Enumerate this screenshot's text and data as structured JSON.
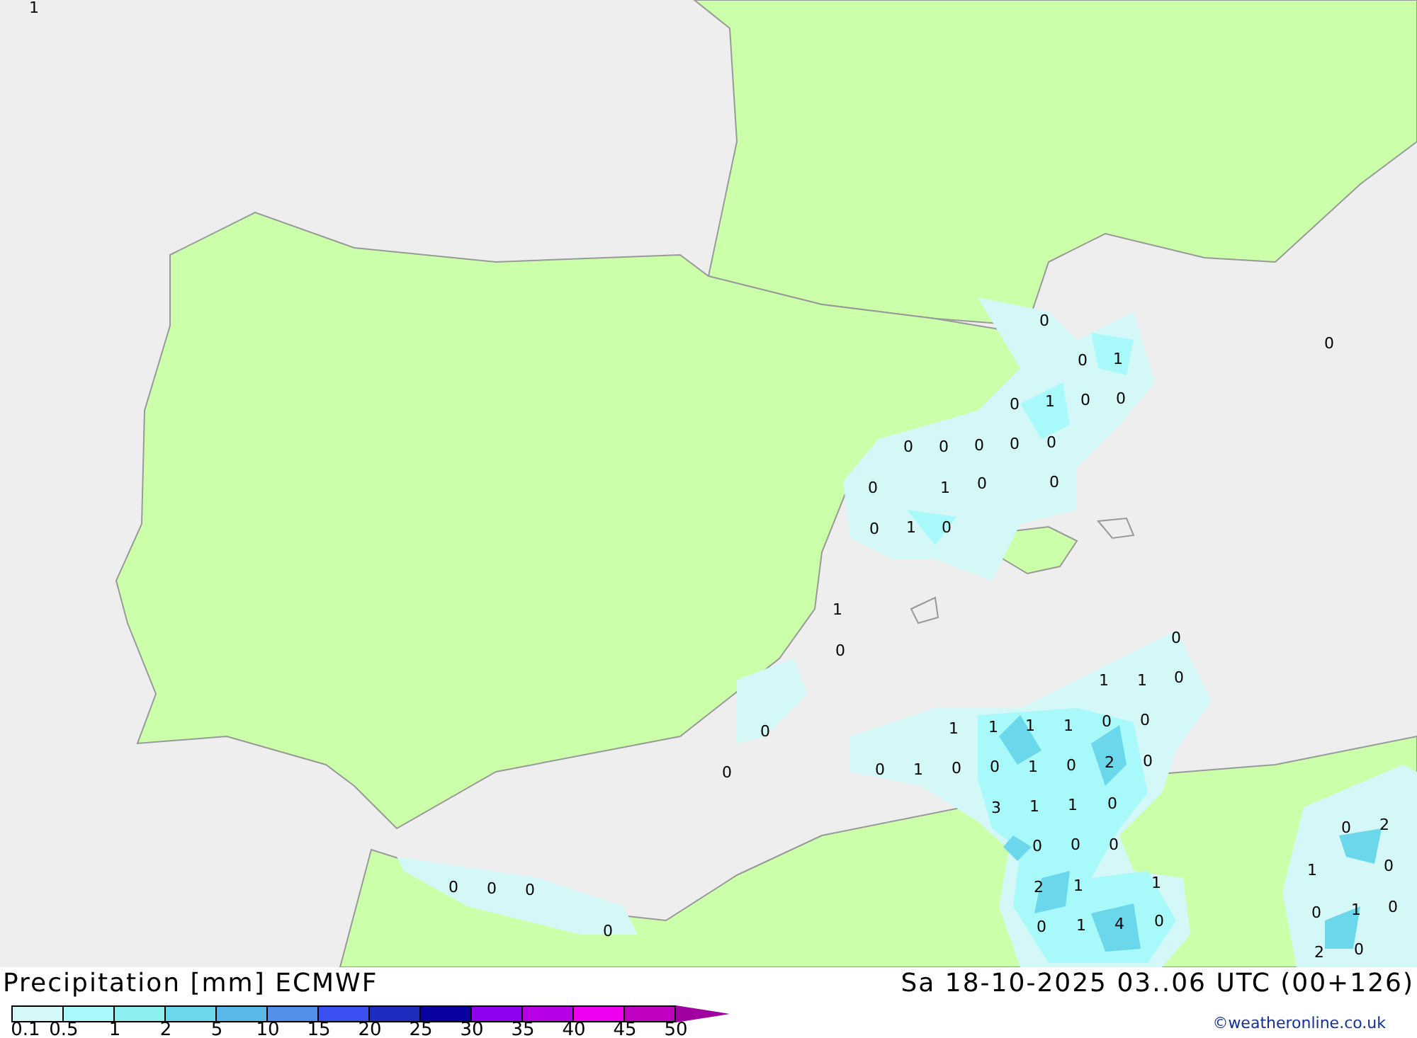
{
  "map": {
    "values": [
      "1",
      "0",
      "0",
      "0",
      "1",
      "0",
      "1",
      "0",
      "0",
      "0",
      "0",
      "0",
      "0",
      "0",
      "0",
      "1",
      "0",
      "0",
      "0",
      "1",
      "0",
      "1",
      "0",
      "0",
      "0",
      "0",
      "1",
      "1",
      "0",
      "1",
      "1",
      "1",
      "1",
      "0",
      "0",
      "0",
      "1",
      "0",
      "0",
      "1",
      "0",
      "2",
      "0",
      "3",
      "1",
      "1",
      "0",
      "0",
      "0",
      "0",
      "2",
      "1",
      "1",
      "0",
      "1",
      "4",
      "0",
      "0",
      "0",
      "0",
      "0",
      "0",
      "2",
      "1",
      "0",
      "0",
      "1",
      "0",
      "2",
      "0"
    ]
  },
  "title": "Precipitation [mm] ECMWF",
  "timestamp": "Sa 18-10-2025 03..06 UTC (00+126)",
  "legend": {
    "swatches": [
      {
        "color": "#d4f8f8"
      },
      {
        "color": "#a8fafa"
      },
      {
        "color": "#8ceeee"
      },
      {
        "color": "#6ad8ea"
      },
      {
        "color": "#58b8e8"
      },
      {
        "color": "#5090e8"
      },
      {
        "color": "#3a50f0"
      },
      {
        "color": "#1e2cc0"
      },
      {
        "color": "#0800a0"
      },
      {
        "color": "#9000f0"
      },
      {
        "color": "#b800e8"
      },
      {
        "color": "#f000f0"
      },
      {
        "color": "#c000c0"
      }
    ],
    "ticks": [
      "0.1",
      "0.5",
      "1",
      "2",
      "5",
      "10",
      "15",
      "20",
      "25",
      "30",
      "35",
      "40",
      "45",
      "50"
    ]
  },
  "credit": "©weatheronline.co.uk"
}
